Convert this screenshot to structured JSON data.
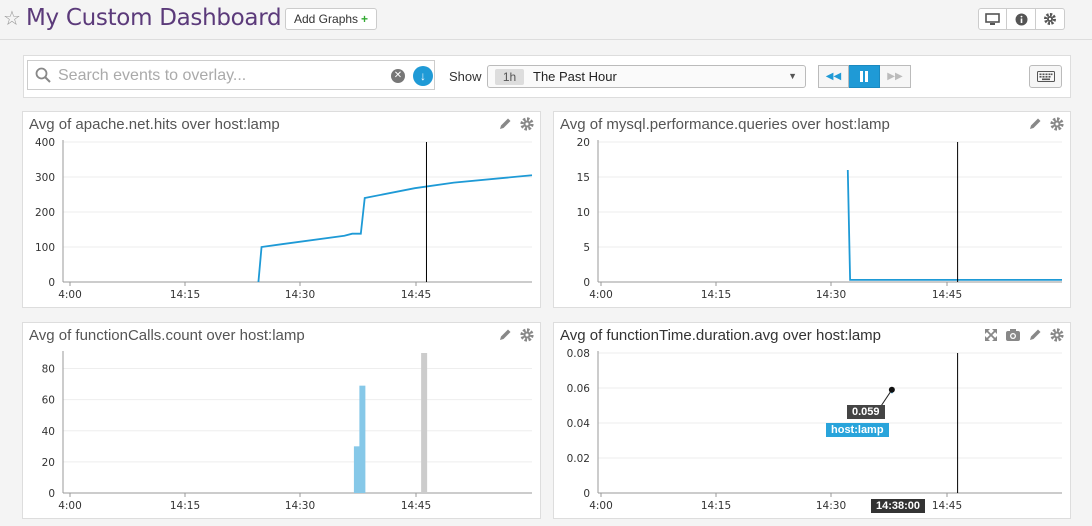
{
  "header": {
    "title": "My Custom Dashboard",
    "add_graphs_label": "Add Graphs",
    "add_graphs_plus": "+",
    "icons": [
      "monitor-icon",
      "info-icon",
      "gear-icon"
    ]
  },
  "controls": {
    "search_placeholder": "Search events to overlay...",
    "show_label": "Show",
    "time_chip": "1h",
    "time_value": "The Past Hour"
  },
  "colors": {
    "accent": "#1f9ad6",
    "series": "#1e9ad6",
    "title": "#5b3a7a",
    "event_bar": "#cccccc"
  },
  "panels": [
    {
      "title": "Avg of apache.net.hits over host:lamp",
      "icons": [
        "pencil-icon",
        "gear-icon"
      ],
      "chart_data": {
        "type": "line",
        "x_ticks": [
          "4:00",
          "14:15",
          "14:30",
          "14:45"
        ],
        "x_range": [
          0,
          60
        ],
        "y_ticks": [
          "0",
          "100",
          "200",
          "300",
          "400"
        ],
        "ylim": [
          0,
          400
        ],
        "series": [
          {
            "x": [
              25,
              25.4,
              28,
              36,
              37,
              37.2,
              38.1,
              38.6,
              45,
              50,
              60
            ],
            "y": [
              0,
              100,
              108,
              132,
              138,
              138,
              138,
              240,
              268,
              284,
              305
            ]
          }
        ],
        "marker_x": 46.5
      }
    },
    {
      "title": "Avg of mysql.performance.queries over host:lamp",
      "icons": [
        "pencil-icon",
        "gear-icon"
      ],
      "chart_data": {
        "type": "line",
        "x_ticks": [
          "4:00",
          "14:15",
          "14:30",
          "14:45"
        ],
        "x_range": [
          0,
          60
        ],
        "y_ticks": [
          "0",
          "5",
          "10",
          "15",
          "20"
        ],
        "ylim": [
          0,
          20
        ],
        "series": [
          {
            "x": [
              32.3,
              32.6,
              40,
              60
            ],
            "y": [
              16,
              0.3,
              0.3,
              0.3
            ]
          }
        ],
        "marker_x": 46.5
      }
    },
    {
      "title": "Avg of functionCalls.count over host:lamp",
      "icons": [
        "pencil-icon",
        "gear-icon"
      ],
      "chart_data": {
        "type": "bar",
        "x_ticks": [
          "4:00",
          "14:15",
          "14:30",
          "14:45"
        ],
        "x_range": [
          0,
          60
        ],
        "y_ticks": [
          "0",
          "20",
          "40",
          "60",
          "80"
        ],
        "ylim": [
          0,
          90
        ],
        "series": [
          {
            "x": [
              37.6,
              38.3
            ],
            "values": [
              30,
              69
            ]
          }
        ],
        "event_x": 46.2
      }
    },
    {
      "title": "Avg of functionTime.duration.avg over host:lamp",
      "icons": [
        "expand-icon",
        "camera-icon",
        "pencil-icon",
        "gear-icon"
      ],
      "chart_data": {
        "type": "line",
        "x_ticks": [
          "4:00",
          "14:15",
          "14:30",
          "14:45"
        ],
        "x_range": [
          0,
          60
        ],
        "y_ticks": [
          "0",
          "0.02",
          "0.04",
          "0.06",
          "0.08"
        ],
        "ylim": [
          0,
          0.08
        ],
        "series": [
          {
            "x": [
              38,
              38
            ],
            "y": [
              0.057,
              0.059
            ]
          }
        ],
        "marker_x": 46.5,
        "tooltip": {
          "value": "0.059",
          "series": "host:lamp",
          "time": "14:38:00"
        }
      }
    }
  ]
}
